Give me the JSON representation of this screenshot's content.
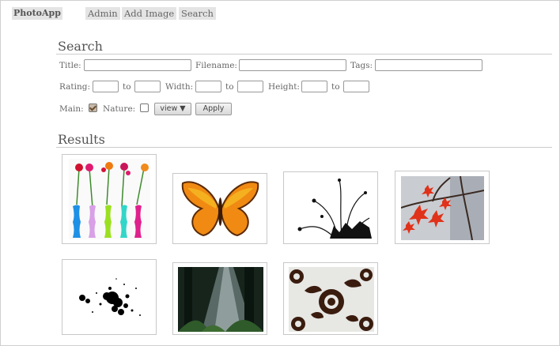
{
  "nav": {
    "brand": "PhotoApp",
    "links": [
      "Admin",
      "Add Image",
      "Search"
    ]
  },
  "search": {
    "heading": "Search",
    "title_label": "Title:",
    "filename_label": "Filename:",
    "tags_label": "Tags:",
    "rating_label": "Rating:",
    "width_label": "Width:",
    "height_label": "Height:",
    "to_label": "to",
    "main_label": "Main:",
    "main_checked": true,
    "nature_label": "Nature:",
    "nature_checked": false,
    "view_select": "view ▼",
    "apply_label": "Apply"
  },
  "results": {
    "heading": "Results",
    "images": [
      "flowers-in-vases-thumbnail",
      "butterfly-thumbnail",
      "plant-silhouette-thumbnail",
      "red-leaves-thumbnail",
      "ink-splatter-thumbnail",
      "forest-light-thumbnail",
      "floral-pattern-thumbnail"
    ]
  }
}
